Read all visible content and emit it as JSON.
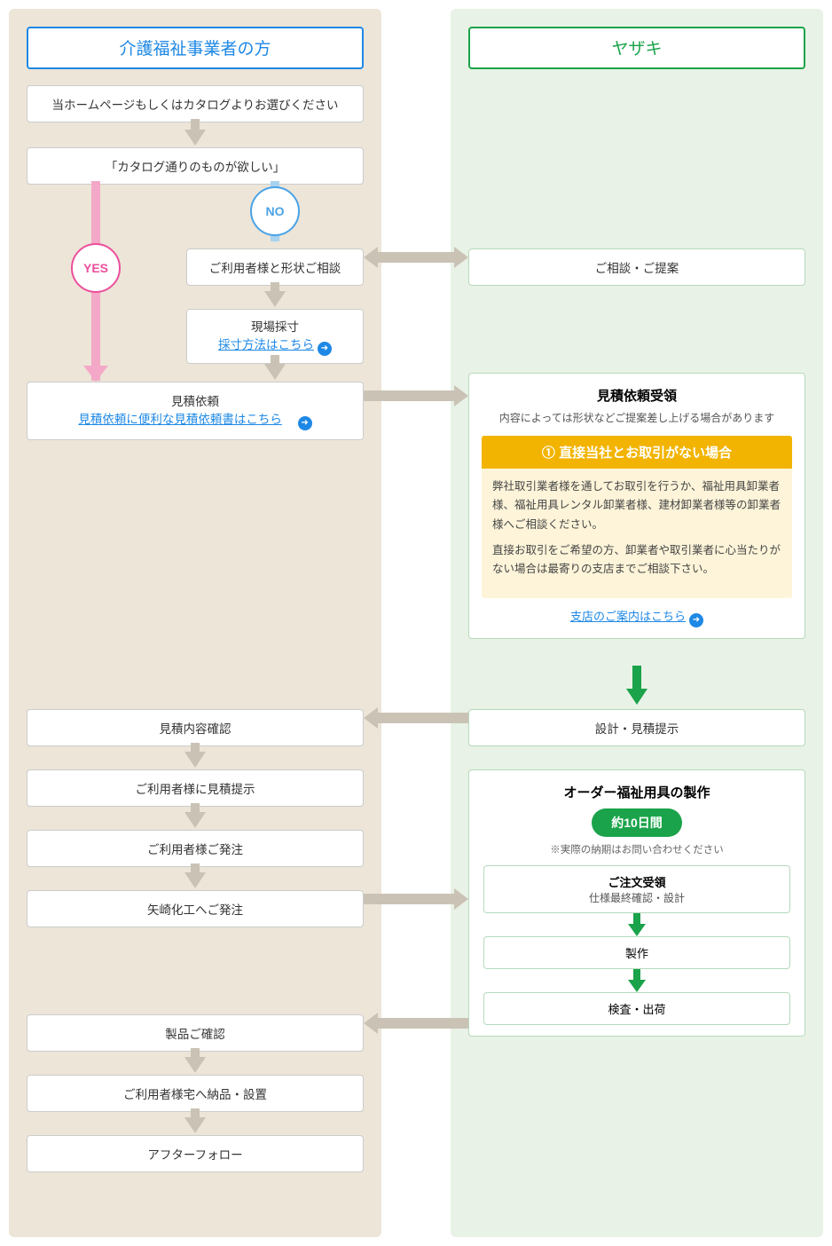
{
  "left": {
    "header": "介護福祉事業者の方",
    "step1": "当ホームページもしくはカタログよりお選びください",
    "step2": "「カタログ通りのものが欲しい」",
    "yes": "YES",
    "no": "NO",
    "consult": "ご利用者様と形状ご相談",
    "measure_title": "現場採寸",
    "measure_link": "採寸方法はこちら",
    "estimate_title": "見積依頼",
    "estimate_link": "見積依頼に便利な見積依頼書はこちら",
    "confirm": "見積内容確認",
    "show": "ご利用者様に見積提示",
    "order1": "ご利用者様ご発注",
    "order2": "矢崎化工へご発注",
    "check": "製品ご確認",
    "deliver": "ご利用者様宅へ納品・設置",
    "follow": "アフターフォロー"
  },
  "right": {
    "header": "ヤザキ",
    "consult": "ご相談・ご提案",
    "estimate_title": "見積依頼受領",
    "estimate_sub": "内容によっては形状などご提案差し上げる場合があります",
    "notice_hdr": "直接当社とお取引がない場合",
    "notice_p1": "弊社取引業者様を通してお取引を行うか、福祉用具卸業者様、福祉用具レンタル卸業者様、建材卸業者様等の卸業者様へご相談ください。",
    "notice_p2": "直接お取引をご希望の方、卸業者や取引業者に心当たりがない場合は最寄りの支店までご相談下さい。",
    "branch_link": "支店のご案内はこちら",
    "design": "設計・見積提示",
    "mfg_title": "オーダー福祉用具の製作",
    "mfg_badge": "約10日間",
    "mfg_note": "※実際の納期はお問い合わせください",
    "mfg_sub1_t": "ご注文受領",
    "mfg_sub1_s": "仕様最終確認・設計",
    "mfg_sub2": "製作",
    "mfg_sub3": "検査・出荷"
  }
}
